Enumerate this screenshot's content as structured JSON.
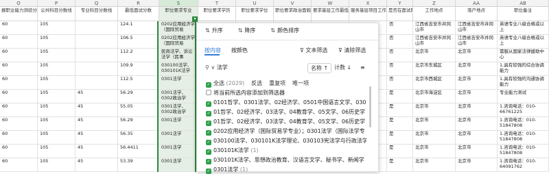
{
  "columns": [
    {
      "letter": "O",
      "header": "报职业能力测验分"
    },
    {
      "letter": "P",
      "header": "公共科目分数线"
    },
    {
      "letter": "Q",
      "header": "专业科目分数线"
    },
    {
      "letter": "R",
      "header": "最低面试分数"
    },
    {
      "letter": "S",
      "header": "职位要求专业"
    },
    {
      "letter": "T",
      "header": "职位要求学历"
    },
    {
      "letter": "U",
      "header": "职位要求学位"
    },
    {
      "letter": "V",
      "header": "职位要求政治面貌"
    },
    {
      "letter": "W",
      "header": "要求基层工作最低年限"
    },
    {
      "letter": "X",
      "header": "服务基层项目工作经历"
    },
    {
      "letter": "Y",
      "header": "是否在面试阶段组织专业考试"
    },
    {
      "letter": "Z",
      "header": "工作地点"
    },
    {
      "letter": "AA",
      "header": "落户地点"
    },
    {
      "letter": "AB",
      "header": "职位备注"
    }
  ],
  "rows": [
    {
      "O": "60",
      "P": "105",
      "Q": "",
      "R": "124.1",
      "S": "0202应用经济学（国际贸易",
      "Y": "否",
      "Z": "江西省吉安市井冈山市",
      "AA": "江西省吉安市井冈山市",
      "AB": "英语专业八级合格或以上"
    },
    {
      "O": "60",
      "P": "105",
      "Q": "",
      "R": "106.5",
      "S": "0202应用经济学（国际贸易",
      "Y": "否",
      "Z": "江西省吉安市井冈山市",
      "AA": "江西省吉安市井冈山市",
      "AB": "英语专业八级合格或以上"
    },
    {
      "O": "60",
      "P": "105",
      "Q": "",
      "R": "112.2",
      "S": "民商法学、诉讼法学（民事",
      "Y": "否",
      "Z": "北京市",
      "AA": "北京市",
      "AB": "需服从国家法律援助中心"
    },
    {
      "O": "60",
      "P": "105",
      "Q": "",
      "R": "109.9",
      "S": "030100法学、030101K法学",
      "Y": "否",
      "Z": "北京市东城区",
      "AA": "北京市",
      "AB": "1.具有较强的综合协调能力"
    },
    {
      "O": "60",
      "P": "105",
      "Q": "",
      "R": "112.5",
      "S": "0301法学",
      "Y": "否",
      "Z": "北京市西城区",
      "AA": "北京市",
      "AB": "1.具有较强的沟通协调能力"
    },
    {
      "O": "60",
      "P": "105",
      "Q": "45",
      "R": "56.29",
      "S": "0301法学、0302政治学",
      "Y": "是",
      "Z": "北京市海淀区",
      "AA": "北京市",
      "AB": "专业能力测试"
    },
    {
      "O": "60",
      "P": "105",
      "Q": "45",
      "R": "55.05",
      "S": "0301法学、0302政治学",
      "Y": "是",
      "Z": "北京市",
      "AA": "北京市",
      "AB": "1.咨询电话：010-66761225"
    },
    {
      "O": "60",
      "P": "105",
      "Q": "45",
      "R": "56.29",
      "S": "0301法学",
      "Y": "是",
      "Z": "北京市",
      "AA": "北京市",
      "AB": "1.咨询电话：010-51847808"
    },
    {
      "O": "60",
      "P": "105",
      "Q": "45",
      "R": "56.35",
      "S": "0301法学",
      "Y": "是",
      "Z": "北京市",
      "AA": "北京市",
      "AB": "1.咨询电话：010-51847808"
    },
    {
      "O": "60",
      "P": "105",
      "Q": "45",
      "R": "56.4411",
      "S": "0301法学",
      "Y": "是",
      "Z": "北京市",
      "AA": "北京市",
      "AB": "1.咨询电话：010-51847808"
    },
    {
      "O": "60",
      "P": "105",
      "Q": "45",
      "R": "53.39",
      "S": "0301法学",
      "Y": "是",
      "Z": "北京市",
      "AA": "北京市",
      "AB": "1.咨询电话：010-64091762"
    }
  ],
  "filter_panel": {
    "sort_asc": "升序",
    "sort_desc": "降序",
    "sort_color": "颜色排序",
    "tab_content": "按内容",
    "tab_color": "按颜色",
    "text_filter": "文本筛选",
    "clear_filter": "清除筛选",
    "search_value": "法学",
    "name_sort": "名称 ↑",
    "count_sort": "计数 ↓",
    "select_all": "全选",
    "select_all_count": "(2029)",
    "invert": "反选",
    "duplicates": "重复项",
    "unique": "唯一项",
    "add_to_filter": "将当前所选内容添加到筛选器",
    "items": [
      {
        "label": "0101哲学、0301法学、02经济学、0501中国语言文学、0302",
        "count": "",
        "checked": true
      },
      {
        "label": "01哲学、02经济学、03法学、04教育学、05文学、06历史学",
        "count": "",
        "checked": true
      },
      {
        "label": "01哲学、02经济学、03法学、04教育学、05文学、06历史学",
        "count": "",
        "checked": true
      },
      {
        "label": "0202应用经济学（国际贸易学专业）；0301法学（国际法学专",
        "count": "",
        "checked": true
      },
      {
        "label": "030100法学、030101K法学理论、030103宪法学与行政法学、",
        "count": "",
        "checked": true
      },
      {
        "label": "030101K法学",
        "count": "(1)",
        "checked": true
      },
      {
        "label": "030101K法学、思想政治教育、汉语言文学、秘书学、新闻学",
        "count": "",
        "checked": true
      },
      {
        "label": "0301法学",
        "count": "(1)",
        "checked": true
      }
    ]
  }
}
